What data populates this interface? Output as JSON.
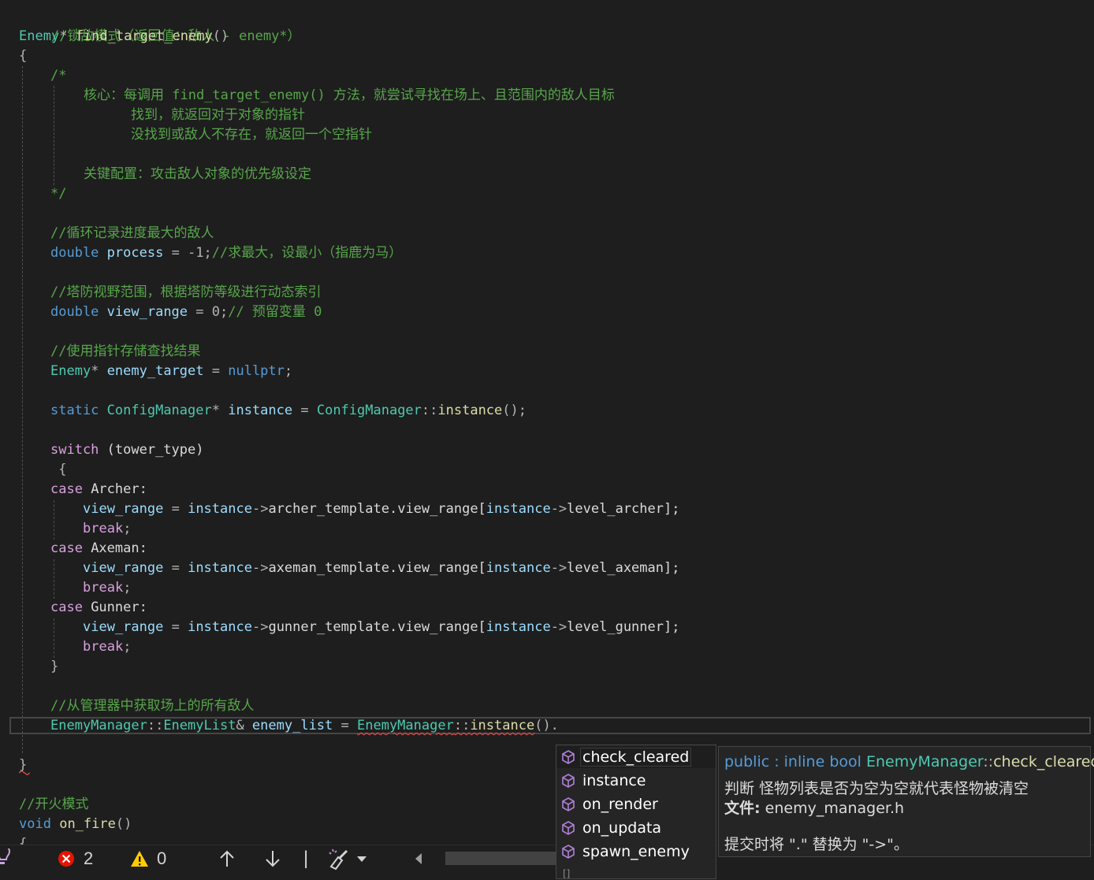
{
  "code": {
    "comment_lock_mode": "//锁敌模式（返回值：敌人 - enemy*）",
    "ret_type": "Enemy",
    "star": "*",
    "func_name": "find_target_enemy",
    "parens": "()",
    "open_brace": "{",
    "block_open": "/*",
    "doc_core": "核心：每调用 find_target_enemy() 方法，就尝试寻找在场上、且范围内的敌人目标",
    "doc_found": "找到，就返回对于对象的指针",
    "doc_notfound": "没找到或敌人不存在，就返回一个空指针",
    "doc_key": "关键配置：攻击敌人对象的优先级设定",
    "block_close": "*/",
    "comment_loop": "//循环记录进度最大的敌人",
    "kw_double": "double",
    "var_process": "process",
    "assign_neg1": " = -1;",
    "comment_max": "//求最大，设最小（指鹿为马）",
    "comment_range": "//塔防视野范围，根据塔防等级进行动态索引",
    "var_view_range": "view_range",
    "assign_zero": " = 0;",
    "comment_reserve": "// 预留变量 0",
    "comment_ptr": "//使用指针存储查找结果",
    "var_enemy_target": "enemy_target",
    "assign": " = ",
    "kw_nullptr": "nullptr",
    "semi": ";",
    "kw_static": "static",
    "type_config": "ConfigManager",
    "var_instance": "instance",
    "scope": "::",
    "fn_instance": "instance",
    "call_end": "();",
    "kw_switch": "switch",
    "switch_arg": " (tower_type)",
    "kw_case": "case",
    "case_archer": " Archer:",
    "case_axeman": " Axeman:",
    "case_gunner": " Gunner:",
    "arrow": "->",
    "archer_tpl": "archer_template.view_range[",
    "archer_lvl": "level_archer];",
    "axeman_tpl": "axeman_template.view_range[",
    "axeman_lvl": "level_axeman];",
    "gunner_tpl": "gunner_template.view_range[",
    "gunner_lvl": "level_gunner];",
    "kw_break": "break",
    "close_brace": "}",
    "comment_get_all": "//从管理器中获取场上的所有敌人",
    "type_enemy_manager": "EnemyManager",
    "type_enemy_list": "EnemyList",
    "amp": "& ",
    "var_enemy_list": "enemy_list",
    "call_dot": "().",
    "comment_fire": "//开火模式",
    "kw_void": "void",
    "fn_on_fire": "on_fire"
  },
  "statusbar": {
    "errors": "2",
    "warnings": "0",
    "separator": "|"
  },
  "completion": {
    "items": [
      "check_cleared",
      "instance",
      "on_render",
      "on_updata",
      "spawn_enemy"
    ],
    "selected_index": 0,
    "footer": "[]"
  },
  "quickinfo": {
    "kw_public": "public",
    "sep1": " : ",
    "kw_inline": "inline",
    "kw_bool": "bool",
    "cls": "EnemyManager",
    "scope": "::",
    "method": "check_cleared",
    "parens": "()",
    "desc": "判断 怪物列表是否为空为空就代表怪物被清空",
    "file_label": "文件:",
    "file_name": " enemy_manager.h",
    "hint": "提交时将 \".\" 替换为 \"->\"。"
  },
  "colors": {
    "background": "#1e1e1e",
    "comment": "#57a64a",
    "keyword": "#569cd6",
    "type": "#4ec9b0",
    "control": "#d8a0df",
    "variable": "#9cdcfe",
    "function": "#dcdcaa",
    "error": "#e51400",
    "warning": "#ffcc00",
    "icon_purple": "#b180d7"
  },
  "icons": [
    "lightbulb-icon",
    "error-icon",
    "warning-icon",
    "arrow-up-icon",
    "arrow-down-icon",
    "cleanup-brush-icon",
    "dropdown-icon",
    "scroll-left-icon",
    "method-cube-icon"
  ]
}
